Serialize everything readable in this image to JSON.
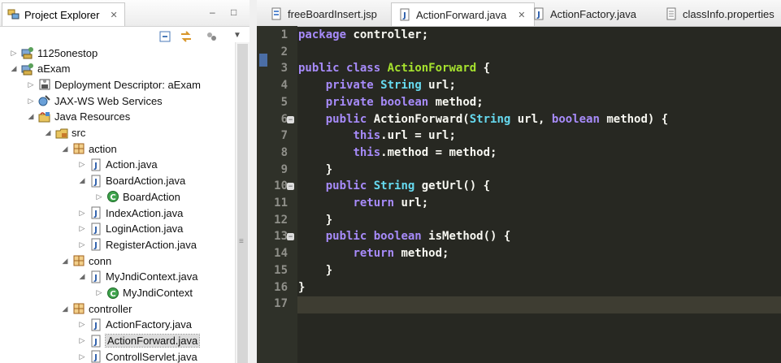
{
  "explorer": {
    "title": "Project Explorer",
    "close_glyph": "✕",
    "minimize_glyph": "–",
    "maximize_glyph": "□",
    "toolbar": [
      "collapse-all-icon",
      "link-with-editor-icon",
      "view-menu-icon"
    ],
    "tree": [
      {
        "label": "1125onestop",
        "depth": 0,
        "state": "collapsed",
        "icon": "project"
      },
      {
        "label": "aExam",
        "depth": 0,
        "state": "expanded",
        "icon": "project"
      },
      {
        "label": "Deployment Descriptor: aExam",
        "depth": 1,
        "state": "collapsed",
        "icon": "descriptor"
      },
      {
        "label": "JAX-WS Web Services",
        "depth": 1,
        "state": "collapsed",
        "icon": "webservice"
      },
      {
        "label": "Java Resources",
        "depth": 1,
        "state": "expanded",
        "icon": "java-resources"
      },
      {
        "label": "src",
        "depth": 2,
        "state": "expanded",
        "icon": "source-folder"
      },
      {
        "label": "action",
        "depth": 3,
        "state": "expanded",
        "icon": "package"
      },
      {
        "label": "Action.java",
        "depth": 4,
        "state": "collapsed",
        "icon": "java-file"
      },
      {
        "label": "BoardAction.java",
        "depth": 4,
        "state": "expanded",
        "icon": "java-file"
      },
      {
        "label": "BoardAction",
        "depth": 5,
        "state": "collapsed",
        "icon": "class"
      },
      {
        "label": "IndexAction.java",
        "depth": 4,
        "state": "collapsed",
        "icon": "java-file"
      },
      {
        "label": "LoginAction.java",
        "depth": 4,
        "state": "collapsed",
        "icon": "java-file"
      },
      {
        "label": "RegisterAction.java",
        "depth": 4,
        "state": "collapsed",
        "icon": "java-file"
      },
      {
        "label": "conn",
        "depth": 3,
        "state": "expanded",
        "icon": "package"
      },
      {
        "label": "MyJndiContext.java",
        "depth": 4,
        "state": "expanded",
        "icon": "java-file"
      },
      {
        "label": "MyJndiContext",
        "depth": 5,
        "state": "collapsed",
        "icon": "class"
      },
      {
        "label": "controller",
        "depth": 3,
        "state": "expanded",
        "icon": "package"
      },
      {
        "label": "ActionFactory.java",
        "depth": 4,
        "state": "collapsed",
        "icon": "java-file"
      },
      {
        "label": "ActionForward.java",
        "depth": 4,
        "state": "collapsed",
        "icon": "java-file",
        "selected": true
      },
      {
        "label": "ControllServlet.java",
        "depth": 4,
        "state": "collapsed",
        "icon": "java-file"
      }
    ]
  },
  "editor": {
    "tabs": [
      {
        "label": "freeBoardInsert.jsp",
        "icon": "jsp-file",
        "active": false
      },
      {
        "label": "ActionForward.java",
        "icon": "java-file",
        "active": true,
        "close": "✕"
      },
      {
        "label": "ActionFactory.java",
        "icon": "java-file",
        "active": false
      },
      {
        "label": "classInfo.properties",
        "icon": "properties-file",
        "active": false
      }
    ],
    "current_line": 17,
    "fold_lines": [
      6,
      10,
      13
    ],
    "lines": [
      [
        [
          "kw2",
          "package"
        ],
        [
          "plain",
          " controller;"
        ]
      ],
      [],
      [
        [
          "kw2",
          "public"
        ],
        [
          "plain",
          " "
        ],
        [
          "kw2",
          "class"
        ],
        [
          "plain",
          " "
        ],
        [
          "cls",
          "ActionForward"
        ],
        [
          "plain",
          " {"
        ]
      ],
      [
        [
          "plain",
          "    "
        ],
        [
          "kw2",
          "private"
        ],
        [
          "plain",
          " "
        ],
        [
          "ty",
          "String"
        ],
        [
          "plain",
          " url;"
        ]
      ],
      [
        [
          "plain",
          "    "
        ],
        [
          "kw2",
          "private"
        ],
        [
          "plain",
          " "
        ],
        [
          "kw2",
          "boolean"
        ],
        [
          "plain",
          " method;"
        ]
      ],
      [
        [
          "plain",
          "    "
        ],
        [
          "kw2",
          "public"
        ],
        [
          "plain",
          " ActionForward("
        ],
        [
          "ty",
          "String"
        ],
        [
          "plain",
          " url, "
        ],
        [
          "kw2",
          "boolean"
        ],
        [
          "plain",
          " method) {"
        ]
      ],
      [
        [
          "plain",
          "        "
        ],
        [
          "kw2",
          "this"
        ],
        [
          "plain",
          ".url = url;"
        ]
      ],
      [
        [
          "plain",
          "        "
        ],
        [
          "kw2",
          "this"
        ],
        [
          "plain",
          ".method = method;"
        ]
      ],
      [
        [
          "plain",
          "    }"
        ]
      ],
      [
        [
          "plain",
          "    "
        ],
        [
          "kw2",
          "public"
        ],
        [
          "plain",
          " "
        ],
        [
          "ty",
          "String"
        ],
        [
          "plain",
          " getUrl() {"
        ]
      ],
      [
        [
          "plain",
          "        "
        ],
        [
          "kw2",
          "return"
        ],
        [
          "plain",
          " url;"
        ]
      ],
      [
        [
          "plain",
          "    }"
        ]
      ],
      [
        [
          "plain",
          "    "
        ],
        [
          "kw2",
          "public"
        ],
        [
          "plain",
          " "
        ],
        [
          "kw2",
          "boolean"
        ],
        [
          "plain",
          " isMethod() {"
        ]
      ],
      [
        [
          "plain",
          "        "
        ],
        [
          "kw2",
          "return"
        ],
        [
          "plain",
          " method;"
        ]
      ],
      [
        [
          "plain",
          "    }"
        ]
      ],
      [
        [
          "plain",
          "}"
        ]
      ],
      []
    ]
  }
}
